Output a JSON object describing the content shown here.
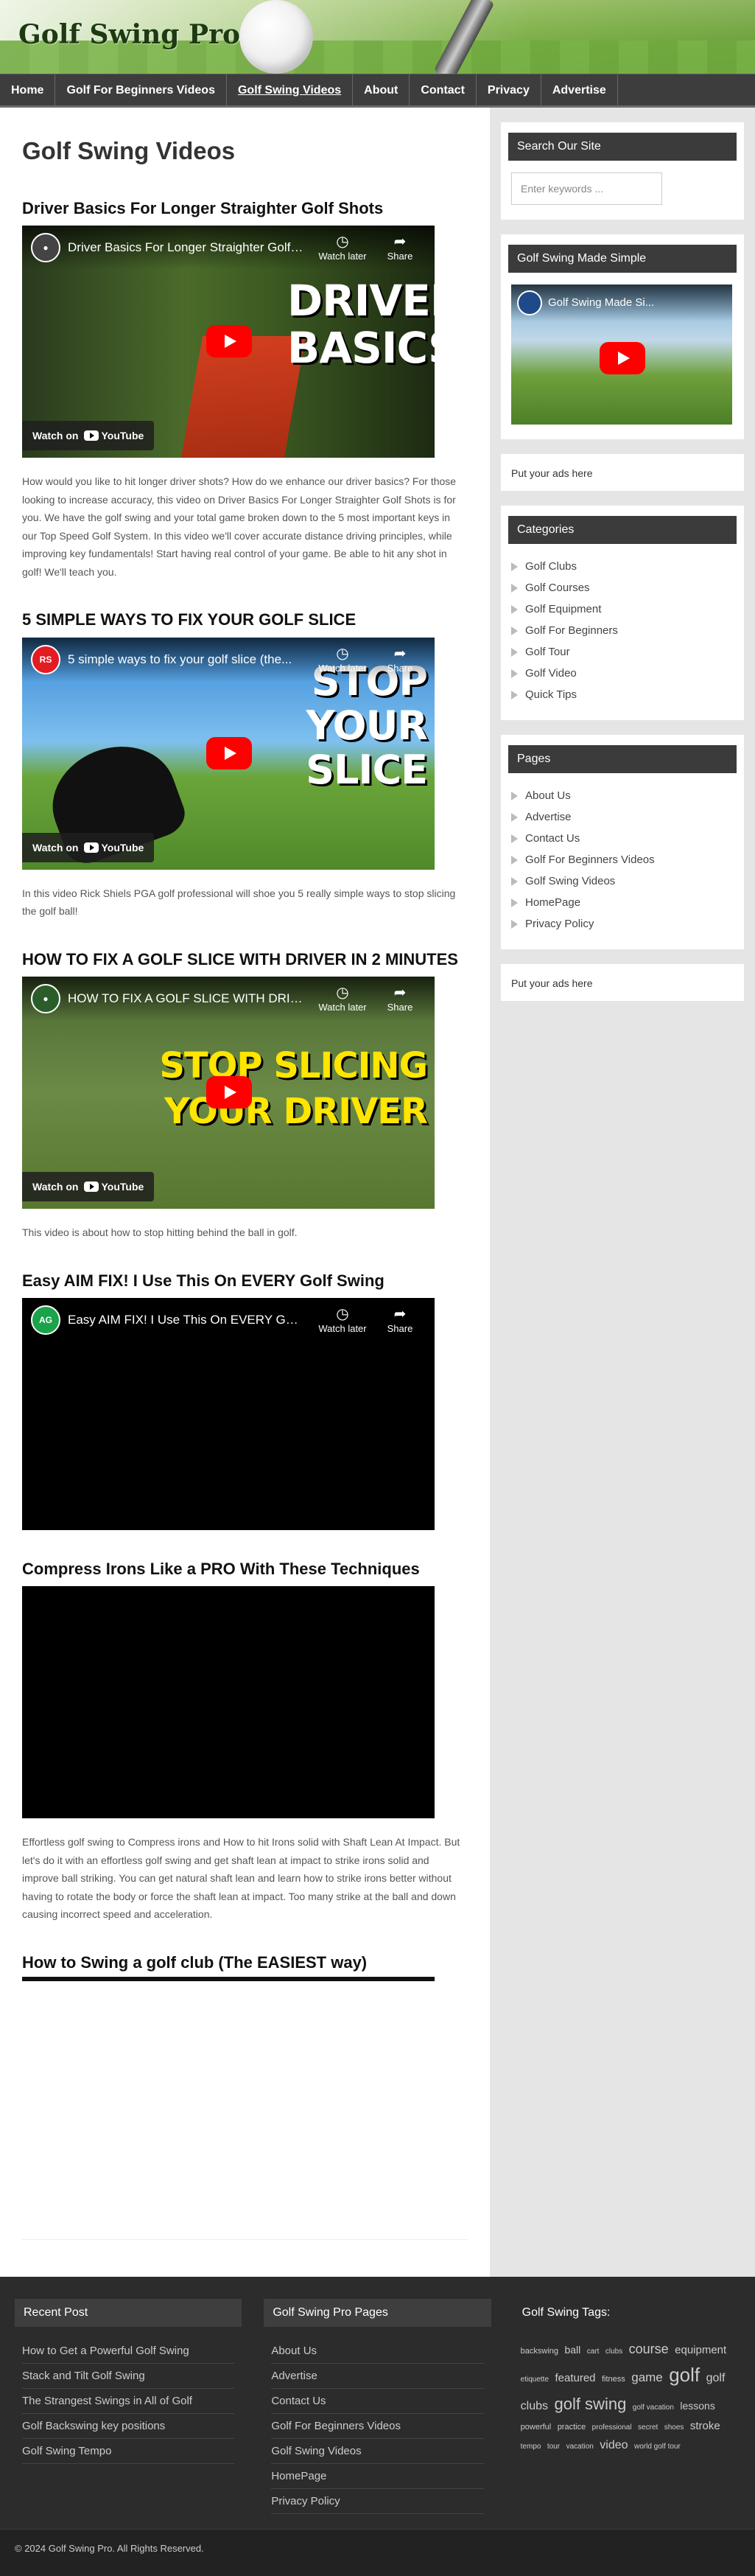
{
  "site": {
    "logo": "Golf Swing Pro"
  },
  "nav": [
    {
      "label": "Home",
      "active": false
    },
    {
      "label": "Golf For Beginners Videos",
      "active": false
    },
    {
      "label": "Golf Swing Videos",
      "active": true
    },
    {
      "label": "About",
      "active": false
    },
    {
      "label": "Contact",
      "active": false
    },
    {
      "label": "Privacy",
      "active": false
    },
    {
      "label": "Advertise",
      "active": false
    }
  ],
  "main": {
    "page_title": "Golf Swing Videos",
    "posts": [
      {
        "title": "Driver Basics For Longer Straighter Golf Shots",
        "video_title": "Driver Basics For Longer Straighter Golf Shots",
        "thumb_text": "DRIVER BASICS",
        "watch_later": "Watch later",
        "share": "Share",
        "watch_on": "Watch on",
        "youtube": "YouTube",
        "description": "How would you like to hit longer driver shots? How do we enhance our driver basics? For those looking to increase accuracy, this video on Driver Basics For Longer Straighter Golf Shots is for you. We have the golf swing and your total game broken down to the 5 most important keys in our Top Speed Golf System. In this video we'll cover accurate distance driving principles, while improving key fundamentals! Start having real control of your game. Be able to hit any shot in golf! We'll teach you."
      },
      {
        "title": "5 SIMPLE WAYS TO FIX YOUR GOLF SLICE",
        "video_title": "5 simple ways to fix your golf slice (the...",
        "thumb_text": "STOP YOUR SLICE",
        "watch_later": "Watch later",
        "share": "Share",
        "watch_on": "Watch on",
        "youtube": "YouTube",
        "description": "In this video Rick Shiels PGA golf professional will shoe you 5 really simple ways to stop slicing the golf ball!"
      },
      {
        "title": "HOW TO FIX A GOLF SLICE WITH DRIVER IN 2 MINUTES",
        "video_title": "HOW TO FIX A GOLF SLICE WITH DRIV...",
        "thumb_text": "STOP SLICING YOUR DRIVER",
        "watch_later": "Watch later",
        "share": "Share",
        "watch_on": "Watch on",
        "youtube": "YouTube",
        "description": "This video is about how to stop hitting behind the ball in golf."
      },
      {
        "title": "Easy AIM FIX! I Use This On EVERY Golf Swing",
        "video_title": "Easy AIM FIX! I Use This On EVERY Gol...",
        "watch_later": "Watch later",
        "share": "Share",
        "description": ""
      },
      {
        "title": "Compress Irons Like a PRO With These Techniques",
        "description": "Effortless golf swing to Compress irons and How to hit Irons solid with Shaft Lean At Impact. But let's do it with an effortless golf swing and get shaft lean at impact to strike irons solid and improve ball striking. You can get natural shaft lean and learn how to strike irons better without having to rotate the body or force the shaft lean at impact. Too many strike at the ball and down causing incorrect speed and acceleration."
      },
      {
        "title": "How to Swing a golf club (The EASIEST way)"
      }
    ]
  },
  "sidebar": {
    "search_title": "Search Our Site",
    "search_placeholder": "Enter keywords ...",
    "video_widget_title": "Golf Swing Made Simple",
    "video_widget_video_title": "Golf Swing Made Si...",
    "ad_text_1": "Put your ads here",
    "categories_title": "Categories",
    "categories": [
      "Golf Clubs",
      "Golf Courses",
      "Golf Equipment",
      "Golf For Beginners",
      "Golf Tour",
      "Golf Video",
      "Quick Tips"
    ],
    "pages_title": "Pages",
    "pages": [
      "About Us",
      "Advertise",
      "Contact Us",
      "Golf For Beginners Videos",
      "Golf Swing Videos",
      "HomePage",
      "Privacy Policy"
    ],
    "ad_text_2": "Put your ads here"
  },
  "footer": {
    "recent_title": "Recent Post",
    "recent": [
      "How to Get a Powerful Golf Swing",
      "Stack and Tilt Golf Swing",
      "The Strangest Swings in All of Golf",
      "Golf Backswing key positions",
      "Golf Swing Tempo"
    ],
    "pages_title": "Golf Swing Pro Pages",
    "pages": [
      "About Us",
      "Advertise",
      "Contact Us",
      "Golf For Beginners Videos",
      "Golf Swing Videos",
      "HomePage",
      "Privacy Policy"
    ],
    "tags_title": "Golf Swing Tags:",
    "tags": [
      {
        "t": "backswing",
        "s": 11
      },
      {
        "t": "ball",
        "s": 14
      },
      {
        "t": "cart",
        "s": 10
      },
      {
        "t": "clubs",
        "s": 10
      },
      {
        "t": "course",
        "s": 18
      },
      {
        "t": "equipment",
        "s": 15
      },
      {
        "t": "etiquette",
        "s": 10
      },
      {
        "t": "featured",
        "s": 15
      },
      {
        "t": "fitness",
        "s": 11
      },
      {
        "t": "game",
        "s": 17
      },
      {
        "t": "golf",
        "s": 26
      },
      {
        "t": "golf clubs",
        "s": 16
      },
      {
        "t": "golf swing",
        "s": 22
      },
      {
        "t": "golf vacation",
        "s": 10
      },
      {
        "t": "lessons",
        "s": 14
      },
      {
        "t": "powerful",
        "s": 11
      },
      {
        "t": "practice",
        "s": 11
      },
      {
        "t": "professional",
        "s": 10
      },
      {
        "t": "secret",
        "s": 10
      },
      {
        "t": "shoes",
        "s": 10
      },
      {
        "t": "stroke",
        "s": 15
      },
      {
        "t": "tempo",
        "s": 10
      },
      {
        "t": "tour",
        "s": 10
      },
      {
        "t": "vacation",
        "s": 10
      },
      {
        "t": "video",
        "s": 16
      },
      {
        "t": "world golf tour",
        "s": 10
      }
    ],
    "copyright": "© 2024 Golf Swing Pro. All Rights Reserved."
  }
}
